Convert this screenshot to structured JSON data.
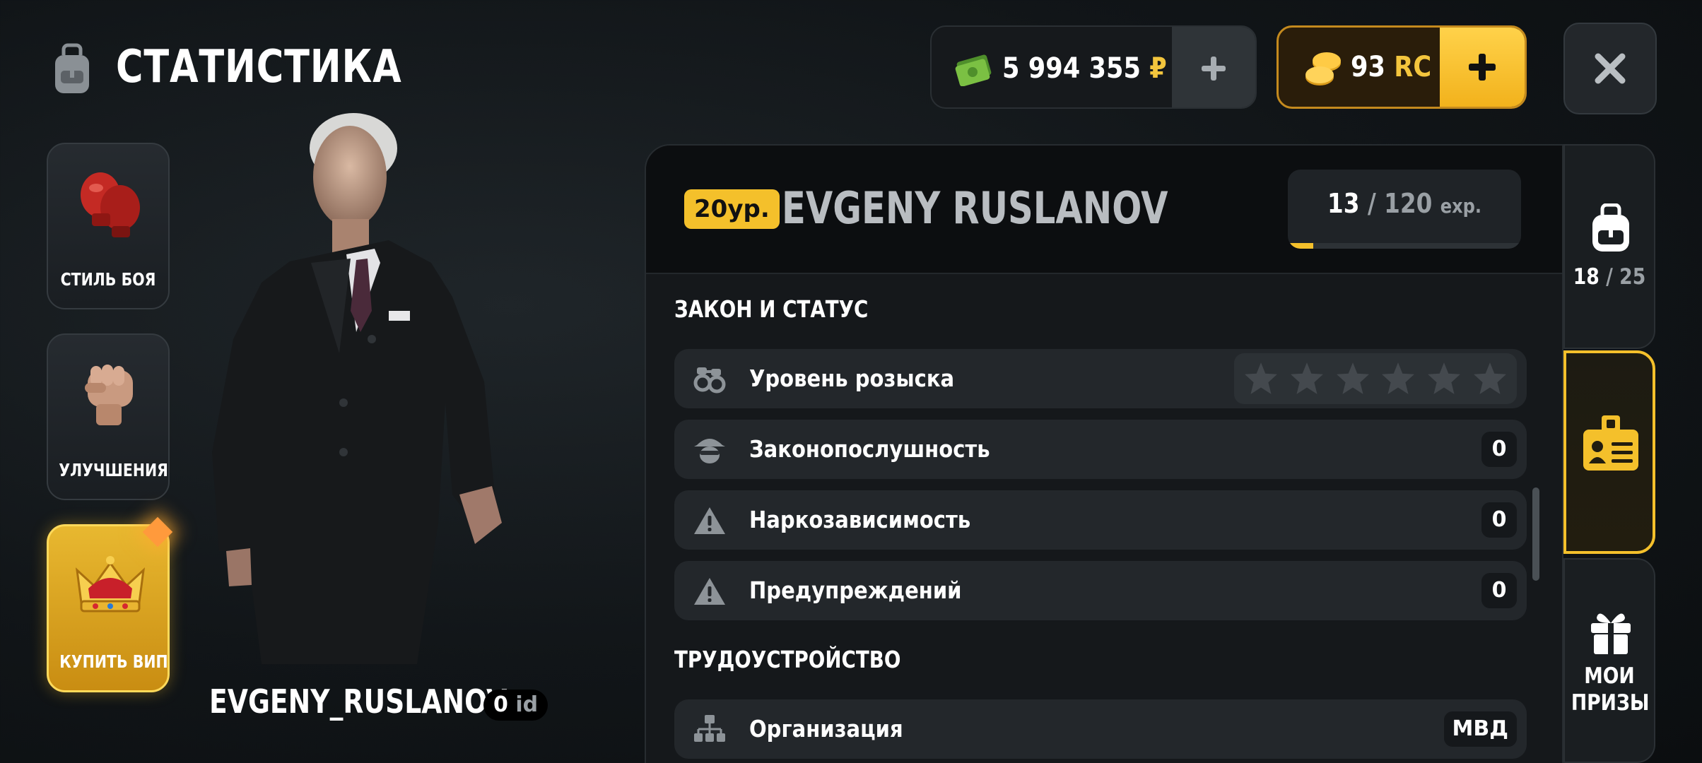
{
  "header": {
    "title": "СТАТИСТИКА"
  },
  "currency": {
    "money": {
      "amount": "5 994 355",
      "symbol": "₽"
    },
    "rc": {
      "amount": "93",
      "symbol": "RC"
    },
    "plus": "+"
  },
  "side_menu": {
    "fight_style": "СТИЛЬ БОЯ",
    "upgrades": "УЛУЧШЕНИЯ",
    "buy_vip": "КУПИТЬ ВИП"
  },
  "character": {
    "nickname": "EVGENY_RUSLANOV",
    "id_number": "0",
    "id_suffix": "id"
  },
  "profile": {
    "level_badge": "20ур.",
    "name": "EVGENY RUSLANOV",
    "exp": {
      "current": "13",
      "sep": "/",
      "max": "120",
      "unit": "exp.",
      "progress": 0.108
    }
  },
  "sections": {
    "law": {
      "title": "ЗАКОН И СТАТУС",
      "rows": [
        {
          "label": "Уровень розыска",
          "stars_filled": 0,
          "stars_total": 6
        },
        {
          "label": "Законопослушность",
          "value": "0"
        },
        {
          "label": "Наркозависимость",
          "value": "0"
        },
        {
          "label": "Предупреждений",
          "value": "0"
        }
      ]
    },
    "employment": {
      "title": "ТРУДОУСТРОЙСТВО",
      "rows": [
        {
          "label": "Организация",
          "value": "МВД"
        }
      ]
    }
  },
  "tabs": {
    "inventory": {
      "current": "18",
      "sep": "/",
      "max": "25"
    },
    "prizes": {
      "line1": "МОИ",
      "line2": "ПРИЗЫ"
    }
  },
  "colors": {
    "accent": "#f4c02b",
    "row_bg": "#23272b",
    "money_icon": "#7bc043"
  }
}
